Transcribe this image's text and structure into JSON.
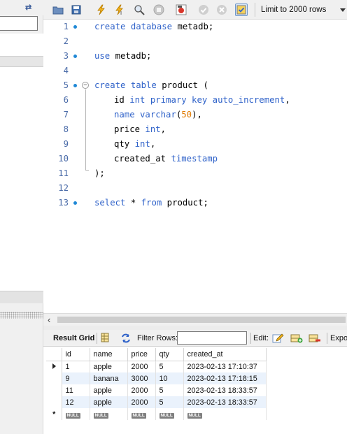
{
  "toolbar": {
    "limit_label": "Limit to 2000 rows",
    "icons": [
      "open-folder-icon",
      "save-icon",
      "execute-icon",
      "execute-current-icon",
      "explain-icon",
      "stop-icon",
      "toggle-output-icon",
      "commit-icon",
      "rollback-icon",
      "autocommit-icon"
    ]
  },
  "editor": {
    "lines": [
      {
        "num": "1",
        "dot": true
      },
      {
        "num": "2",
        "dot": false
      },
      {
        "num": "3",
        "dot": true
      },
      {
        "num": "4",
        "dot": false
      },
      {
        "num": "5",
        "dot": true
      },
      {
        "num": "6",
        "dot": false
      },
      {
        "num": "7",
        "dot": false
      },
      {
        "num": "8",
        "dot": false
      },
      {
        "num": "9",
        "dot": false
      },
      {
        "num": "10",
        "dot": false
      },
      {
        "num": "11",
        "dot": false
      },
      {
        "num": "12",
        "dot": false
      },
      {
        "num": "13",
        "dot": true
      }
    ],
    "code": {
      "l1": {
        "kw1": "create database",
        "rest": " metadb;"
      },
      "l3": {
        "kw1": "use",
        "rest": " metadb;"
      },
      "l5": {
        "kw1": "create table",
        "rest": " product ("
      },
      "l6": {
        "name": "id",
        "kw1": " int primary key auto_increment",
        "rest": ","
      },
      "l7": {
        "kw0": "name",
        "kw1": " varchar",
        "p1": "(",
        "num": "50",
        "p2": "),"
      },
      "l8": {
        "name": "price",
        "kw1": " int",
        "rest": ","
      },
      "l9": {
        "name": "qty",
        "kw1": " int",
        "rest": ","
      },
      "l10": {
        "name": "created_at",
        "kw1": " timestamp",
        "rest": ""
      },
      "l11": {
        "rest": ");"
      },
      "l13": {
        "kw1": "select",
        "mid": " * ",
        "kw2": "from",
        "rest": " product;"
      }
    }
  },
  "result": {
    "result_grid_label": "Result Grid",
    "filter_label": "Filter Rows:",
    "filter_value": "",
    "edit_label": "Edit:",
    "export_label": "Expo",
    "columns": [
      "id",
      "name",
      "price",
      "qty",
      "created_at"
    ],
    "rows": [
      {
        "id": "1",
        "name": "apple",
        "price": "2000",
        "qty": "5",
        "created_at": "2023-02-13 17:10:37"
      },
      {
        "id": "9",
        "name": "banana",
        "price": "3000",
        "qty": "10",
        "created_at": "2023-02-13 17:18:15"
      },
      {
        "id": "11",
        "name": "apple",
        "price": "2000",
        "qty": "5",
        "created_at": "2023-02-13 18:33:57"
      },
      {
        "id": "12",
        "name": "apple",
        "price": "2000",
        "qty": "5",
        "created_at": "2023-02-13 18:33:57"
      }
    ],
    "null_label": "NULL",
    "new_row_marker": "*"
  },
  "colors": {
    "keyword": "#2f62c9",
    "number": "#e07a00",
    "line_number": "#4a6ba8",
    "statement_dot": "#1f88d6",
    "alt_row": "#eaf2fc"
  }
}
